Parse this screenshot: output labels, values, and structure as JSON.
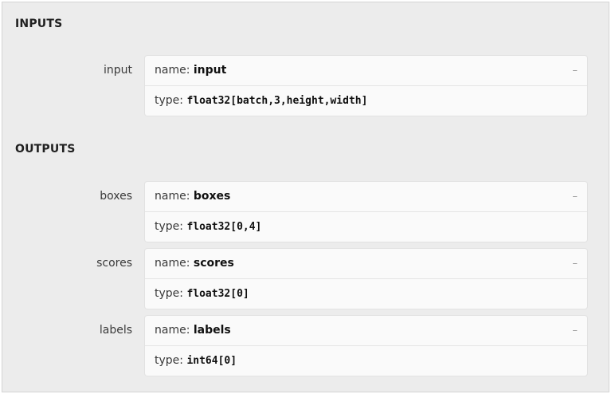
{
  "inputs": {
    "title": "INPUTS",
    "items": [
      {
        "label": "input",
        "name_key": "name:",
        "name": "input",
        "type_key": "type:",
        "type": "float32[batch,3,height,width]",
        "toggle": "–"
      }
    ]
  },
  "outputs": {
    "title": "OUTPUTS",
    "items": [
      {
        "label": "boxes",
        "name_key": "name:",
        "name": "boxes",
        "type_key": "type:",
        "type": "float32[0,4]",
        "toggle": "–"
      },
      {
        "label": "scores",
        "name_key": "name:",
        "name": "scores",
        "type_key": "type:",
        "type": "float32[0]",
        "toggle": "–"
      },
      {
        "label": "labels",
        "name_key": "name:",
        "name": "labels",
        "type_key": "type:",
        "type": "int64[0]",
        "toggle": "–"
      }
    ]
  }
}
